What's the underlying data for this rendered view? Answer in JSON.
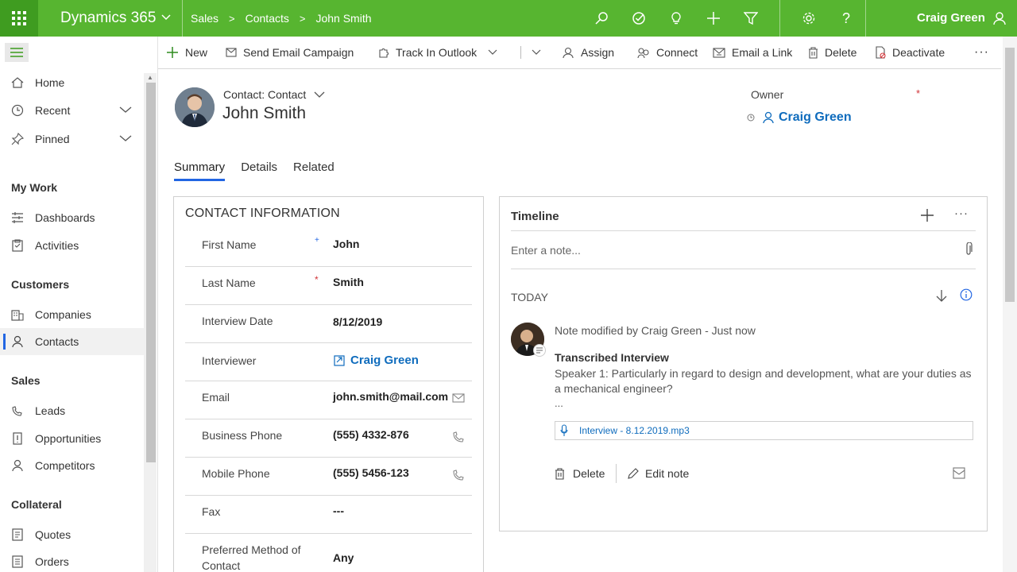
{
  "topbar": {
    "app_title": "Dynamics 365",
    "breadcrumbs": [
      "Sales",
      "Contacts",
      "John Smith"
    ],
    "user_name": "Craig Green",
    "icons": [
      "search-icon",
      "task-check-icon",
      "lightbulb-icon",
      "plus-icon",
      "filter-icon",
      "gear-icon",
      "help-icon",
      "person-icon"
    ],
    "brand_color": "#57b530"
  },
  "commands": {
    "new": "New",
    "send_email_campaign": "Send Email Campaign",
    "track_in_outlook": "Track In Outlook",
    "assign": "Assign",
    "connect": "Connect",
    "email_a_link": "Email a Link",
    "delete": "Delete",
    "deactivate": "Deactivate",
    "more": "···"
  },
  "sidebar": {
    "top_items": [
      {
        "label": "Home",
        "icon": "home-icon"
      },
      {
        "label": "Recent",
        "icon": "clock-icon"
      },
      {
        "label": "Pinned",
        "icon": "pin-icon"
      }
    ],
    "groups": [
      {
        "title": "My Work",
        "items": [
          {
            "label": "Dashboards"
          },
          {
            "label": "Activities"
          }
        ]
      },
      {
        "title": "Customers",
        "items": [
          {
            "label": "Companies"
          },
          {
            "label": "Contacts"
          }
        ]
      },
      {
        "title": "Sales",
        "items": [
          {
            "label": "Leads"
          },
          {
            "label": "Opportunities"
          },
          {
            "label": "Competitors"
          }
        ]
      },
      {
        "title": "Collateral",
        "items": [
          {
            "label": "Quotes"
          },
          {
            "label": "Orders"
          }
        ]
      }
    ],
    "active": "Contacts"
  },
  "record": {
    "type_label": "Contact: Contact",
    "name": "John Smith",
    "owner_label": "Owner",
    "owner_value": "Craig Green"
  },
  "tabs": [
    "Summary",
    "Details",
    "Related"
  ],
  "contact_info": {
    "title": "CONTACT INFORMATION",
    "fields": [
      {
        "label": "First Name",
        "value": "John"
      },
      {
        "label": "Last Name",
        "value": "Smith"
      },
      {
        "label": "Interview Date",
        "value": "8/12/2019"
      },
      {
        "label": "Interviewer",
        "value": "Craig Green"
      },
      {
        "label": "Email",
        "value": "john.smith@mail.com"
      },
      {
        "label": "Business Phone",
        "value": "(555) 4332-876"
      },
      {
        "label": "Mobile Phone",
        "value": "(555) 5456-123"
      },
      {
        "label": "Fax",
        "value": "---"
      },
      {
        "label": "Preferred Method of Contact",
        "value": "Any"
      }
    ]
  },
  "timeline": {
    "title": "Timeline",
    "note_placeholder": "Enter a note...",
    "today_label": "TODAY",
    "entry": {
      "meta": "Note modified by Craig Green  -  Just now",
      "subject": "Transcribed Interview",
      "body": "Speaker 1: Particularly in regard to design and development, what are your duties as a mechanical engineer?",
      "ellipsis": "...",
      "attachment": "Interview - 8.12.2019.mp3",
      "delete_label": "Delete",
      "edit_label": "Edit note"
    }
  }
}
